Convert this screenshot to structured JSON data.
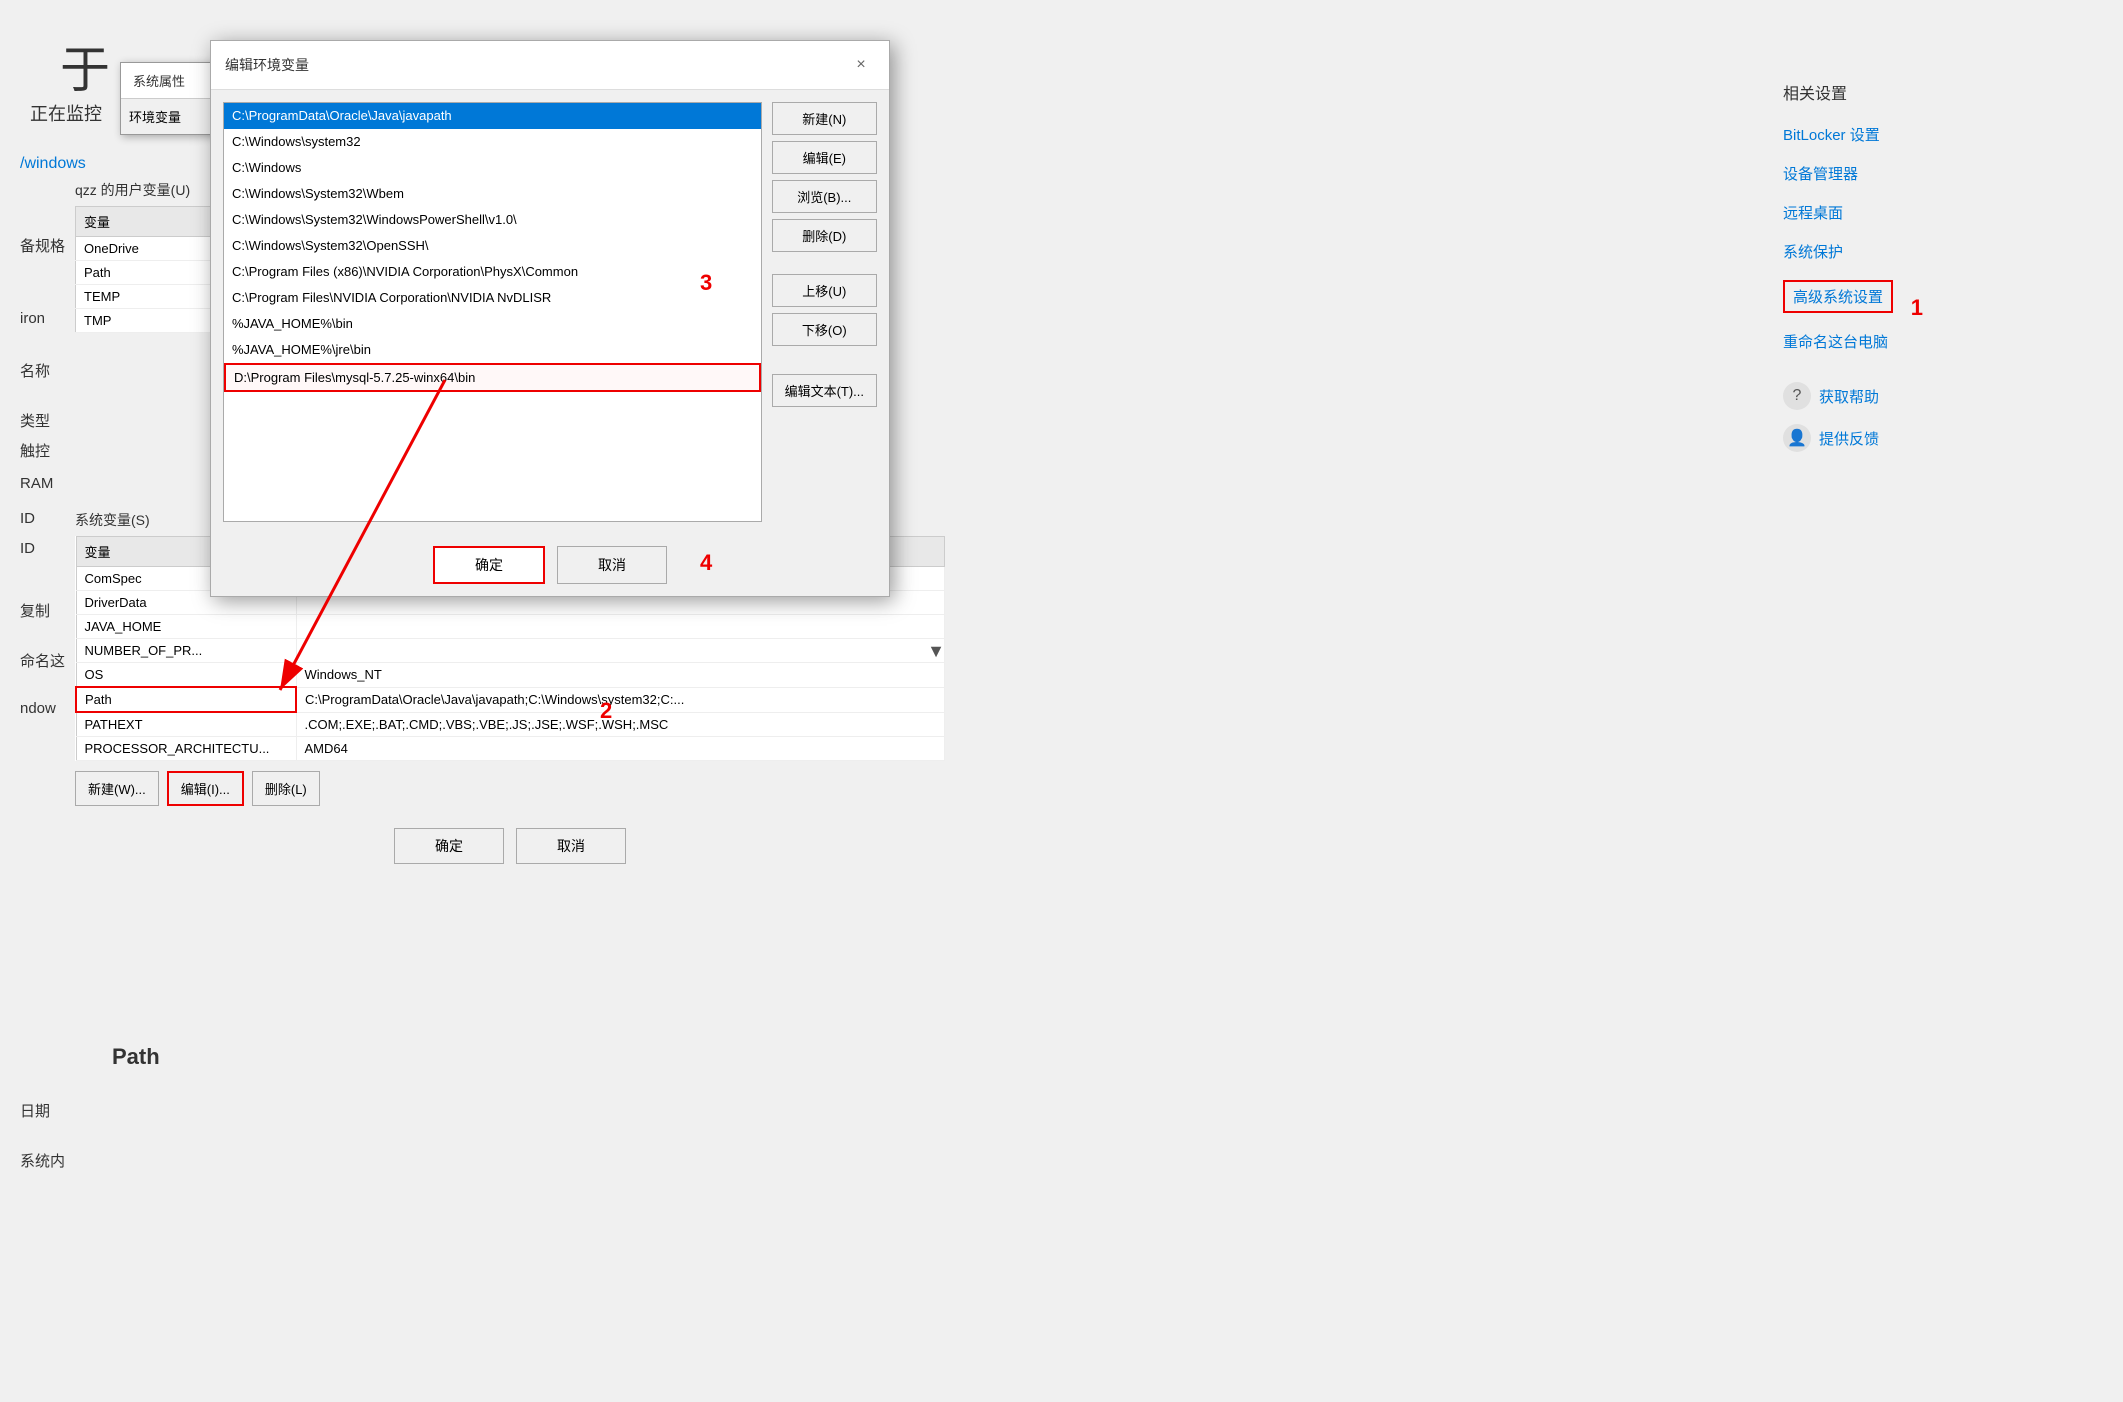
{
  "background": {
    "leftTitle": "于",
    "monitoring": "正在监控",
    "windowsPath": "/windows",
    "rulesLabel": "备规格",
    "computerName": "iron",
    "labels": {
      "name": "名称",
      "type": "类型",
      "touch": "触控",
      "ram": "RAM",
      "id1": "ID",
      "id2": "ID",
      "copy": "复制",
      "rename": "命名这",
      "windows": "ndow",
      "date": "日期",
      "sysSize": "系统内"
    }
  },
  "sysProps": {
    "title": "系统属性",
    "envVarsLabel": "环境变量"
  },
  "editEnvDialog": {
    "title": "编辑环境变量",
    "closeBtn": "×",
    "paths": [
      {
        "value": "C:\\ProgramData\\Oracle\\Java\\javapath",
        "selected": true
      },
      {
        "value": "C:\\Windows\\system32"
      },
      {
        "value": "C:\\Windows"
      },
      {
        "value": "C:\\Windows\\System32\\Wbem"
      },
      {
        "value": "C:\\Windows\\System32\\WindowsPowerShell\\v1.0\\"
      },
      {
        "value": "C:\\Windows\\System32\\OpenSSH\\"
      },
      {
        "value": "C:\\Program Files (x86)\\NVIDIA Corporation\\PhysX\\Common"
      },
      {
        "value": "C:\\Program Files\\NVIDIA Corporation\\NVIDIA NvDLISR"
      },
      {
        "value": "%JAVA_HOME%\\bin"
      },
      {
        "value": "%JAVA_HOME%\\jre\\bin"
      },
      {
        "value": "D:\\Program Files\\mysql-5.7.25-winx64\\bin",
        "boxed": true
      }
    ],
    "buttons": {
      "new": "新建(N)",
      "edit": "编辑(E)",
      "browse": "浏览(B)...",
      "delete": "删除(D)",
      "moveUp": "上移(U)",
      "moveDown": "下移(O)",
      "editText": "编辑文本(T)..."
    },
    "footer": {
      "ok": "确定",
      "cancel": "取消"
    }
  },
  "userVarSection": {
    "title": "qzz 的用户变量(U)",
    "columns": [
      "变量",
      ""
    ],
    "rows": [
      {
        "var": "OneDrive",
        "value": ""
      },
      {
        "var": "Path",
        "value": ""
      },
      {
        "var": "TEMP",
        "value": ""
      },
      {
        "var": "TMP",
        "value": ""
      }
    ]
  },
  "sysVarSection": {
    "title": "系统变量(S)",
    "columns": [
      "变量",
      ""
    ],
    "rows": [
      {
        "var": "ComSpec",
        "value": ""
      },
      {
        "var": "DriverData",
        "value": ""
      },
      {
        "var": "JAVA_HOME",
        "value": ""
      },
      {
        "var": "NUMBER_OF_PR...",
        "value": ""
      },
      {
        "var": "OS",
        "value": "Windows_NT"
      },
      {
        "var": "Path",
        "value": "C:\\ProgramData\\Oracle\\Java\\javapath;C:\\Windows\\system32;C:...",
        "highlighted": true
      },
      {
        "var": "PATHEXT",
        "value": ".COM;.EXE;.BAT;.CMD;.VBS;.VBE;.JS;.JSE;.WSF;.WSH;.MSC"
      },
      {
        "var": "PROCESSOR_ARCHITECTU...",
        "value": "AMD64"
      }
    ],
    "buttons": {
      "new": "新建(W)...",
      "edit": "编辑(I)...",
      "delete": "删除(L)"
    },
    "footer": {
      "ok": "确定",
      "cancel": "取消"
    }
  },
  "rightPanel": {
    "title": "相关设置",
    "links": [
      {
        "id": "bitlocker",
        "label": "BitLocker 设置"
      },
      {
        "id": "device-manager",
        "label": "设备管理器"
      },
      {
        "id": "remote-desktop",
        "label": "远程桌面"
      },
      {
        "id": "sys-protection",
        "label": "系统保护"
      },
      {
        "id": "advanced-sys-settings",
        "label": "高级系统设置",
        "highlighted": true
      },
      {
        "id": "rename-pc",
        "label": "重命名这台电脑"
      }
    ],
    "help": [
      {
        "icon": "?",
        "label": "获取帮助"
      },
      {
        "icon": "👤",
        "label": "提供反馈"
      }
    ]
  },
  "annotations": {
    "num1": "1",
    "num2": "2",
    "num3": "3",
    "num4": "4"
  }
}
